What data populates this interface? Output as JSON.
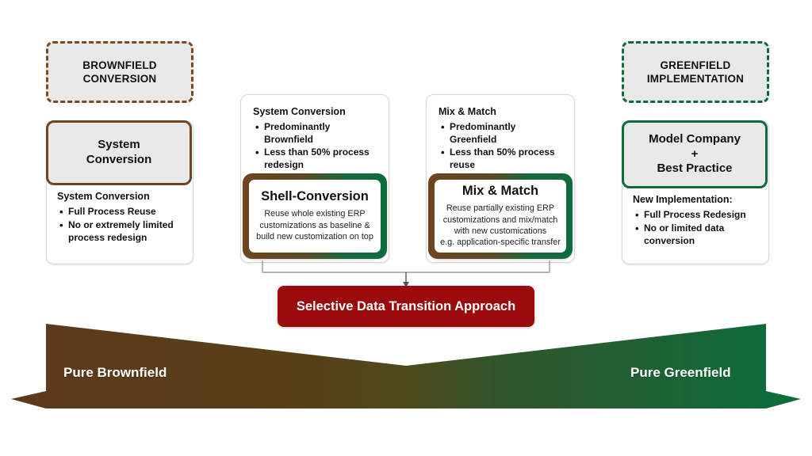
{
  "diagram": {
    "title_left_pill": "BROWNFIELD\nCONVERSION",
    "title_right_pill": "GREENFIELD\nIMPLEMENTATION"
  },
  "left_pill": {
    "line1": "BROWNFIELD",
    "line2": "CONVERSION"
  },
  "right_pill": {
    "line1": "GREENFIELD",
    "line2": "IMPLEMENTATION"
  },
  "left_card": {
    "header_line1": "System",
    "header_line2": "Conversion",
    "body_title": "System Conversion",
    "bullets": [
      "Full Process Reuse",
      "No or extremely limited process redesign"
    ]
  },
  "right_card": {
    "header_line1": "Model Company",
    "header_line2": "+",
    "header_line3": "Best Practice",
    "body_title": "New Implementation:",
    "bullets": [
      "Full Process Redesign",
      "No or limited data conversion"
    ]
  },
  "mid_left_card": {
    "title": "System Conversion",
    "bullets": [
      "Predominantly Brownfield",
      "Less than 50% process redesign"
    ],
    "inner_title": "Shell-Conversion",
    "inner_lines": [
      "Reuse whole existing ERP",
      "customizations as baseline &",
      "build new customization on top"
    ]
  },
  "mid_right_card": {
    "title": "Mix & Match",
    "bullets": [
      "Predominantly Greenfield",
      "Less than 50% process reuse"
    ],
    "inner_title": "Mix & Match",
    "inner_lines": [
      "Reuse partially existing ERP",
      "customizations and mix/match",
      "with new customications",
      "e.g. application-specific transfer"
    ]
  },
  "banner": {
    "label": "Selective Data Transition Approach"
  },
  "spectrum": {
    "left_label": "Pure Brownfield",
    "right_label": "Pure Greenfield"
  },
  "colors": {
    "brown": "#6E4520",
    "brown_dash": "#7B4A22",
    "brown_fill": "#5C3A1B",
    "green": "#0E6B3B",
    "green_fill": "#0E6B3B",
    "red": "#9B0B0B",
    "pill_bg": "#E9E9E9",
    "card_border": "#D8D8D8",
    "connector": "#9A9A9A"
  }
}
